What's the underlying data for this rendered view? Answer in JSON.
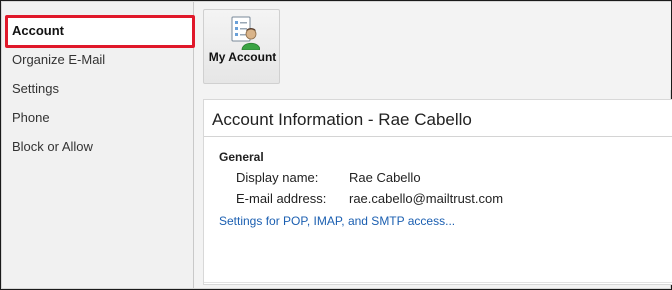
{
  "sidebar": {
    "items": [
      {
        "label": "Account"
      },
      {
        "label": "Organize E-Mail"
      },
      {
        "label": "Settings"
      },
      {
        "label": "Phone"
      },
      {
        "label": "Block or Allow"
      }
    ]
  },
  "toolbar": {
    "my_account_label": "My Account",
    "my_account_icon": "account-settings-icon"
  },
  "panel": {
    "title": "Account Information - Rae Cabello",
    "group_title": "General",
    "rows": [
      {
        "label": "Display name:",
        "value": "Rae Cabello"
      },
      {
        "label": "E-mail address:",
        "value": "rae.cabello@mailtrust.com"
      }
    ],
    "settings_link": "Settings for POP, IMAP, and SMTP access..."
  },
  "colors": {
    "highlight": "#e0182a",
    "link": "#1b5fb1"
  }
}
